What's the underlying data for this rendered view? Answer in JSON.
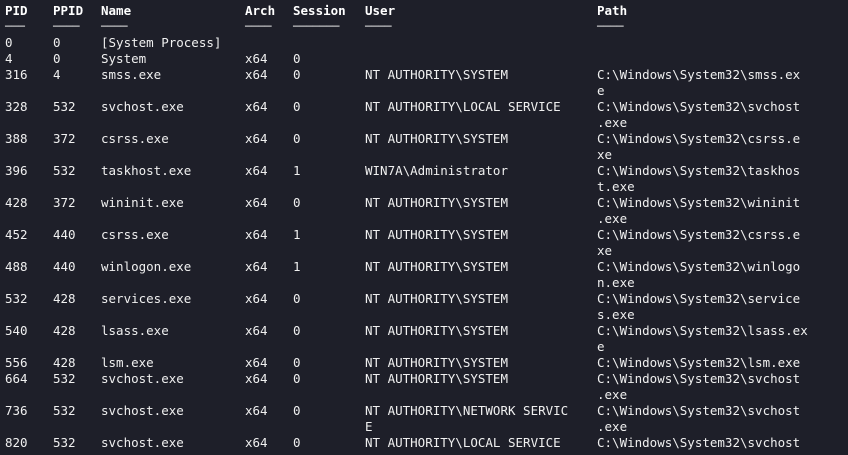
{
  "terminal": {
    "headers": {
      "pid": "PID",
      "ppid": "PPID",
      "name": "Name",
      "arch": "Arch",
      "session": "Session",
      "user": "User",
      "path": "Path"
    },
    "underlines": {
      "pid": "───",
      "ppid": "────",
      "name": "────",
      "arch": "────",
      "session": "───────",
      "user": "────",
      "path": "────"
    },
    "rows": [
      [
        "0",
        "0",
        "[System Process]",
        "",
        "",
        "",
        ""
      ],
      [
        "4",
        "0",
        "System",
        "x64",
        "0",
        "",
        ""
      ],
      [
        "316",
        "4",
        "smss.exe",
        "x64",
        "0",
        "NT AUTHORITY\\SYSTEM",
        "C:\\Windows\\System32\\smss.ex"
      ],
      [
        "",
        "",
        "",
        "",
        "",
        "",
        "e"
      ],
      [
        "328",
        "532",
        "svchost.exe",
        "x64",
        "0",
        "NT AUTHORITY\\LOCAL SERVICE",
        "C:\\Windows\\System32\\svchost"
      ],
      [
        "",
        "",
        "",
        "",
        "",
        "",
        ".exe"
      ],
      [
        "388",
        "372",
        "csrss.exe",
        "x64",
        "0",
        "NT AUTHORITY\\SYSTEM",
        "C:\\Windows\\System32\\csrss.e"
      ],
      [
        "",
        "",
        "",
        "",
        "",
        "",
        "xe"
      ],
      [
        "396",
        "532",
        "taskhost.exe",
        "x64",
        "1",
        "WIN7A\\Administrator",
        "C:\\Windows\\System32\\taskhos"
      ],
      [
        "",
        "",
        "",
        "",
        "",
        "",
        "t.exe"
      ],
      [
        "428",
        "372",
        "wininit.exe",
        "x64",
        "0",
        "NT AUTHORITY\\SYSTEM",
        "C:\\Windows\\System32\\wininit"
      ],
      [
        "",
        "",
        "",
        "",
        "",
        "",
        ".exe"
      ],
      [
        "452",
        "440",
        "csrss.exe",
        "x64",
        "1",
        "NT AUTHORITY\\SYSTEM",
        "C:\\Windows\\System32\\csrss.e"
      ],
      [
        "",
        "",
        "",
        "",
        "",
        "",
        "xe"
      ],
      [
        "488",
        "440",
        "winlogon.exe",
        "x64",
        "1",
        "NT AUTHORITY\\SYSTEM",
        "C:\\Windows\\System32\\winlogo"
      ],
      [
        "",
        "",
        "",
        "",
        "",
        "",
        "n.exe"
      ],
      [
        "532",
        "428",
        "services.exe",
        "x64",
        "0",
        "NT AUTHORITY\\SYSTEM",
        "C:\\Windows\\System32\\service"
      ],
      [
        "",
        "",
        "",
        "",
        "",
        "",
        "s.exe"
      ],
      [
        "540",
        "428",
        "lsass.exe",
        "x64",
        "0",
        "NT AUTHORITY\\SYSTEM",
        "C:\\Windows\\System32\\lsass.ex"
      ],
      [
        "",
        "",
        "",
        "",
        "",
        "",
        "e"
      ],
      [
        "556",
        "428",
        "lsm.exe",
        "x64",
        "0",
        "NT AUTHORITY\\SYSTEM",
        "C:\\Windows\\System32\\lsm.exe"
      ],
      [
        "664",
        "532",
        "svchost.exe",
        "x64",
        "0",
        "NT AUTHORITY\\SYSTEM",
        "C:\\Windows\\System32\\svchost"
      ],
      [
        "",
        "",
        "",
        "",
        "",
        "",
        ".exe"
      ],
      [
        "736",
        "532",
        "svchost.exe",
        "x64",
        "0",
        "NT AUTHORITY\\NETWORK SERVIC",
        "C:\\Windows\\System32\\svchost"
      ],
      [
        "",
        "",
        "",
        "",
        "",
        "E",
        ".exe"
      ],
      [
        "820",
        "532",
        "svchost.exe",
        "x64",
        "0",
        "NT AUTHORITY\\LOCAL SERVICE",
        "C:\\Windows\\System32\\svchost"
      ]
    ]
  },
  "colors": {
    "background": "#1e1f29",
    "text": "#f0f0f0"
  }
}
